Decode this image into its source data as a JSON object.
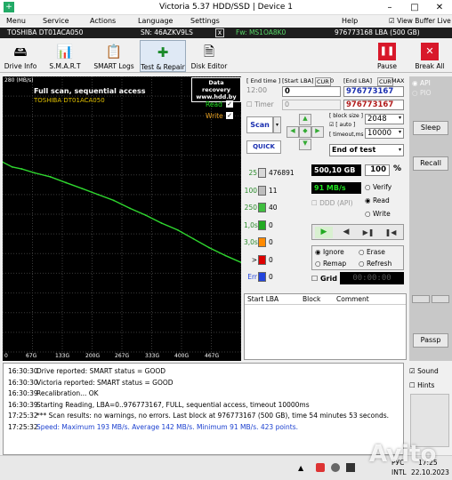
{
  "window": {
    "title": "Victoria 5.37 HDD/SSD | Device 1"
  },
  "menu": [
    "Menu",
    "Service",
    "Actions",
    "Language",
    "Settings",
    "Help"
  ],
  "view_buffer": "View Buffer Live",
  "infobar": {
    "model": "TOSHIBA DT01ACA050",
    "serial": "SN: 46AZKV9LS",
    "close": "x",
    "firmware": "Fw: MS1OA8K0",
    "capacity": "976773168 LBA (500 GB)"
  },
  "toolbar": {
    "drive_info": "Drive Info",
    "smart": "S.M.A.R.T",
    "smart_logs": "SMART Logs",
    "test_repair": "Test & Repair",
    "disk_editor": "Disk Editor",
    "pause": "Pause",
    "break_all": "Break All"
  },
  "graph": {
    "y_max_label": "280 (MB/s)",
    "scan_title": "Full scan, sequential access",
    "model": "TOSHIBA DT01ACA050",
    "recovery_line1": "Data recovery",
    "recovery_line2": "www.hdd.by",
    "read_label": "Read",
    "write_label": "Write",
    "x_ticks": [
      "0",
      "67G",
      "133G",
      "200G",
      "267G",
      "333G",
      "400G",
      "467G"
    ]
  },
  "chart_data": {
    "type": "line",
    "title": "Full scan, sequential access",
    "ylabel": "(MB/s)",
    "ylim": [
      0,
      280
    ],
    "x": [
      0,
      20,
      40,
      67,
      100,
      133,
      167,
      200,
      233,
      267,
      300,
      333,
      367,
      400,
      433,
      467,
      500
    ],
    "series": [
      {
        "name": "Read",
        "values": [
          193,
          188,
          186,
          182,
          178,
          172,
          166,
          160,
          154,
          146,
          139,
          131,
          124,
          115,
          106,
          98,
          91
        ]
      }
    ]
  },
  "timer": {
    "end_time_lbl": "[ End time ]",
    "start_lba_lbl": "[Start LBA]",
    "cur_lbl": "CUR",
    "zero_lbl": "0",
    "end_lba_lbl": "[End LBA]",
    "max_lbl": "MAX",
    "time_val": "12:00",
    "start_lba_val": "0",
    "end_lba_val": "976773167",
    "timer_lbl": "Timer",
    "timer_val": "0",
    "end_lba2": "976773167",
    "block_size_lbl": "[ block size ]",
    "auto_lbl": "[ auto ]",
    "timeout_lbl": "[ timeout,ms ]",
    "block_size": "2048",
    "timeout": "10000",
    "scan_btn": "Scan",
    "quick_btn": "QUICK",
    "end_of_test": "End of test"
  },
  "stats": {
    "rows": [
      {
        "ms": "25",
        "count": "476891",
        "color": "#d9d9d9"
      },
      {
        "ms": "100",
        "count": "11",
        "color": "#bdbdbd"
      },
      {
        "ms": "250",
        "count": "40",
        "color": "#3fbf3f"
      },
      {
        "ms": "1,0s",
        "count": "0",
        "color": "#22aa22"
      },
      {
        "ms": "3,0s",
        "count": "0",
        "color": "#ff8a00"
      },
      {
        "ms": ">",
        "count": "0",
        "color": "#dd0000"
      },
      {
        "ms": "Err",
        "count": "0",
        "color": "#2244dd"
      }
    ],
    "size": "500,10 GB",
    "percent": "100",
    "pct_sign": "%",
    "speed": "91 MB/s",
    "ddd": "DDD (API)",
    "verify": "Verify",
    "read": "Read",
    "write": "Write",
    "ignore": "Ignore",
    "erase": "Erase",
    "remap": "Remap",
    "refresh": "Refresh",
    "grid": "Grid",
    "elapsed": "00:00:00"
  },
  "lba_table": {
    "headers": [
      "Start LBA",
      "Block",
      "Comment"
    ]
  },
  "right": {
    "api": "API",
    "pio": "PIO",
    "sleep": "Sleep",
    "recall": "Recall",
    "passp": "Passp"
  },
  "log": [
    {
      "time": "16:30:30",
      "msg": "Drive reported: SMART status = GOOD",
      "color": "#000"
    },
    {
      "time": "16:30:30",
      "msg": "Victoria reported: SMART status = GOOD",
      "color": "#000"
    },
    {
      "time": "16:30:39",
      "msg": "Recalibration... OK",
      "color": "#000"
    },
    {
      "time": "16:30:39",
      "msg": "Starting Reading, LBA=0..976773167, FULL, sequential access, timeout 10000ms",
      "color": "#000"
    },
    {
      "time": "17:25:32",
      "msg": "*** Scan results: no warnings, no errors. Last block at 976773167 (500 GB), time 54 minutes 53 seconds.",
      "color": "#000"
    },
    {
      "time": "17:25:32",
      "msg": "Speed: Maximum 193 MB/s. Average 142 MB/s. Minimum 91 MB/s. 423 points.",
      "color": "#1a3fcf"
    }
  ],
  "log_side": {
    "sound": "Sound",
    "hints": "Hints"
  },
  "taskbar": {
    "lang": "РУС",
    "kb": "INTL",
    "time": "17:25",
    "date": "22.10.2023"
  },
  "watermark": "Avito"
}
